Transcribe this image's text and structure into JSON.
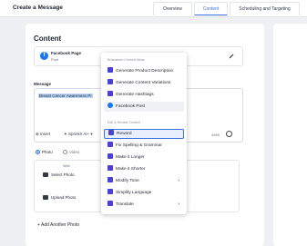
{
  "header": {
    "title": "Create a Message",
    "tabs": [
      "Overview",
      "Content",
      "Scheduling and Targeting"
    ]
  },
  "content": {
    "section_title": "Content",
    "page": {
      "name": "Facebook Page",
      "type": "Post",
      "avatar_letter": "f"
    },
    "message_label": "Message",
    "message_text": "Breast Cancer Awareness Pr",
    "insert_label": "Insert",
    "sprinklr_label": "Sprinklr AI+",
    "char_count": "4969",
    "media_types": [
      "Photo",
      "Video"
    ],
    "write_label": "Write",
    "select_photo": "Select Photo",
    "upload_photo": "Upload Photo",
    "add_photo": "+ Add Another Photo"
  },
  "menu": {
    "section1_title": "Brainstorm Content Ideas",
    "section1_items": [
      "Generate Product Description",
      "Generate Content Variations",
      "Generate Hashtags",
      "Facebook Post"
    ],
    "section2_title": "Edit & Review Content",
    "section2_items": [
      "Reword",
      "Fix Spelling & Grammar",
      "Make it Longer",
      "Make it Shorter",
      "Modify Tone",
      "Simplify Language",
      "Translate"
    ]
  },
  "colors": {
    "accent": "#3b6ee0",
    "facebook": "#1877f2",
    "ai_icon": "#4b3fd8"
  }
}
